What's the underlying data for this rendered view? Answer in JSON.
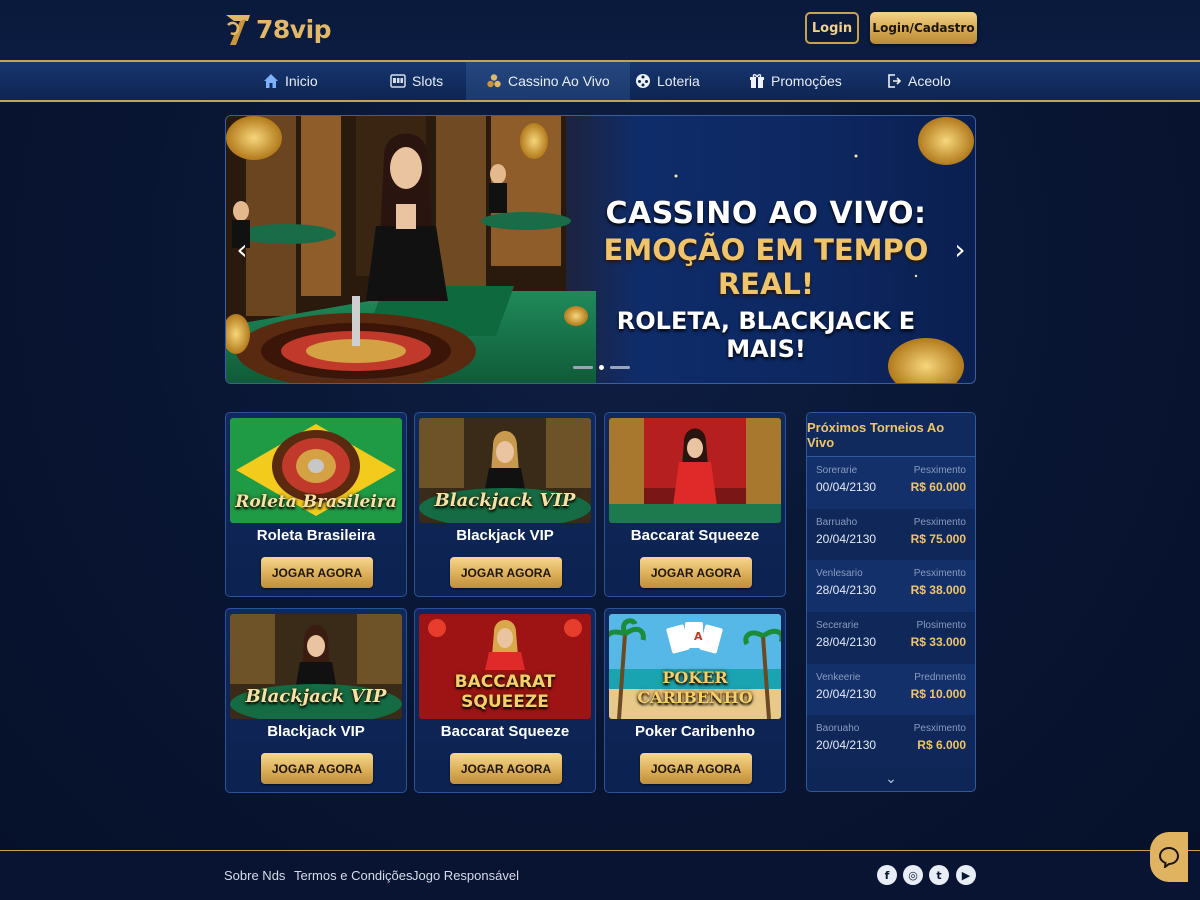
{
  "brand": {
    "name": "78vip",
    "gold": "#e2b866",
    "navy": "#0b1c41"
  },
  "header": {
    "login_label": "Login",
    "register_label": "Login/Cadastro"
  },
  "nav": [
    {
      "label": "Inicio",
      "icon": "home-icon"
    },
    {
      "label": "Slots",
      "icon": "slot-machine-icon"
    },
    {
      "label": "Cassino Ao Vivo",
      "icon": "chips-icon",
      "active": true
    },
    {
      "label": "Loteria",
      "icon": "lottery-ball-icon"
    },
    {
      "label": "Promoções",
      "icon": "gift-icon"
    },
    {
      "label": "Aceolo",
      "icon": "exit-icon"
    }
  ],
  "hero": {
    "line1": "CASSINO AO VIVO:",
    "line2": "EMOÇÃO EM TEMPO REAL!",
    "line3": "ROLETA, BLACKJACK E MAIS!",
    "slides": 3,
    "active_slide": 2
  },
  "games": [
    {
      "title": "Roleta Brasileira",
      "thumb_text": "Roleta Brasileira",
      "button": "JOGAR AGORA"
    },
    {
      "title": "Blackjack VIP",
      "thumb_text": "Blackjack VIP",
      "button": "JOGAR AGORA"
    },
    {
      "title": "Baccarat Squeeze",
      "thumb_text": "",
      "button": "JOGAR AGORA"
    },
    {
      "title": "Blackjack VIP",
      "thumb_text": "Blackjack VIP",
      "button": "JOGAR AGORA"
    },
    {
      "title": "Baccarat Squeeze",
      "thumb_text": "BACCARAT SQUEEZE",
      "button": "JOGAR AGORA"
    },
    {
      "title": "Poker Caribenho",
      "thumb_text": "POKER CARIBENHO",
      "button": "JOGAR AGORA"
    }
  ],
  "tournaments": {
    "title": "Próximos Torneios Ao Vivo",
    "rows": [
      {
        "day": "Sorerarie",
        "date": "00/04/2130",
        "status": "Pesximento",
        "prize": "R$ 60.000"
      },
      {
        "day": "Barruaho",
        "date": "20/04/2130",
        "status": "Pesximento",
        "prize": "R$ 75.000"
      },
      {
        "day": "Venlesario",
        "date": "28/04/2130",
        "status": "Pesximento",
        "prize": "R$ 38.000"
      },
      {
        "day": "Secerarie",
        "date": "28/04/2130",
        "status": "Plosimento",
        "prize": "R$ 33.000"
      },
      {
        "day": "Venkeerie",
        "date": "20/04/2130",
        "status": "Prednnento",
        "prize": "R$ 10.000"
      },
      {
        "day": "Baoruaho",
        "date": "20/04/2130",
        "status": "Pesximento",
        "prize": "R$ 6.000"
      }
    ]
  },
  "footer": {
    "links": [
      "Sobre Nds",
      "Termos e Condições",
      "Jogo Responsável"
    ],
    "social": [
      {
        "icon": "facebook-icon",
        "glyph": "f"
      },
      {
        "icon": "instagram-icon",
        "glyph": "◎"
      },
      {
        "icon": "twitter-icon",
        "glyph": "t"
      },
      {
        "icon": "youtube-icon",
        "glyph": "▶"
      }
    ]
  }
}
